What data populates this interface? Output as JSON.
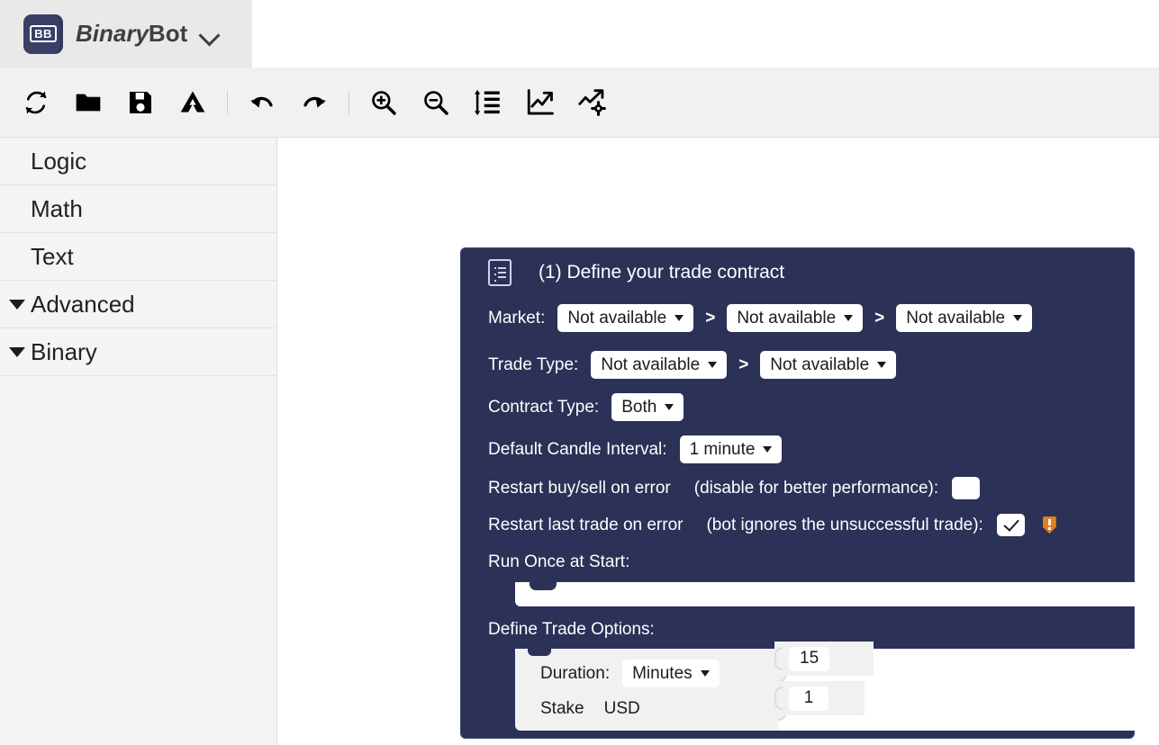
{
  "header": {
    "logo_mark": "BB",
    "brand_word1": "Binary",
    "brand_word2": "Bot",
    "caret_icon": "chevron-down-icon"
  },
  "toolbar": {
    "buttons": [
      {
        "name": "reset-button",
        "icon": "refresh-icon"
      },
      {
        "name": "open-button",
        "icon": "folder-icon"
      },
      {
        "name": "save-button",
        "icon": "floppy-disk-icon"
      },
      {
        "name": "google-drive-button",
        "icon": "google-drive-icon"
      },
      {
        "name": "undo-button",
        "icon": "undo-arrow-icon"
      },
      {
        "name": "redo-button",
        "icon": "redo-arrow-icon"
      },
      {
        "name": "zoom-in-button",
        "icon": "magnifier-plus-icon"
      },
      {
        "name": "zoom-out-button",
        "icon": "magnifier-minus-icon"
      },
      {
        "name": "sort-blocks-button",
        "icon": "line-height-list-icon"
      },
      {
        "name": "chart-button",
        "icon": "line-chart-icon"
      },
      {
        "name": "chart-settings-button",
        "icon": "chart-gear-icon"
      }
    ]
  },
  "sidebar": {
    "items": [
      {
        "label": "Logic",
        "expandable": false
      },
      {
        "label": "Math",
        "expandable": false
      },
      {
        "label": "Text",
        "expandable": false
      },
      {
        "label": "Advanced",
        "expandable": true
      },
      {
        "label": "Binary",
        "expandable": true
      }
    ]
  },
  "block": {
    "icon": "document-list-icon",
    "title": "(1) Define your trade contract",
    "market": {
      "label": "Market:",
      "separator": ">",
      "values": [
        "Not available",
        "Not available",
        "Not available"
      ]
    },
    "trade_type": {
      "label": "Trade Type:",
      "separator": ">",
      "values": [
        "Not available",
        "Not available"
      ]
    },
    "contract_type": {
      "label": "Contract Type:",
      "value": "Both"
    },
    "candle_interval": {
      "label": "Default Candle Interval:",
      "value": "1 minute"
    },
    "restart_buysell": {
      "label": "Restart buy/sell on error",
      "hint": "(disable for better performance):",
      "checked": false
    },
    "restart_last_trade": {
      "label": "Restart last trade on error",
      "hint": "(bot ignores the unsuccessful trade):",
      "checked": true,
      "check_glyph": "check-mark",
      "warning_icon": "warning-shield-icon"
    },
    "run_once": {
      "label": "Run Once at Start:"
    },
    "trade_options": {
      "label": "Define Trade Options:",
      "duration": {
        "label": "Duration:",
        "unit": "Minutes",
        "value": "15"
      },
      "stake": {
        "label": "Stake",
        "currency": "USD",
        "value": "1"
      }
    }
  },
  "colors": {
    "block_bg": "#2b3157",
    "brand_bar": "#e9e9ea",
    "toolbar_bg": "#f1f1f1",
    "sidebar_bg": "#f4f4f4",
    "warning": "#e1801c",
    "field_bg": "#ffffff"
  }
}
